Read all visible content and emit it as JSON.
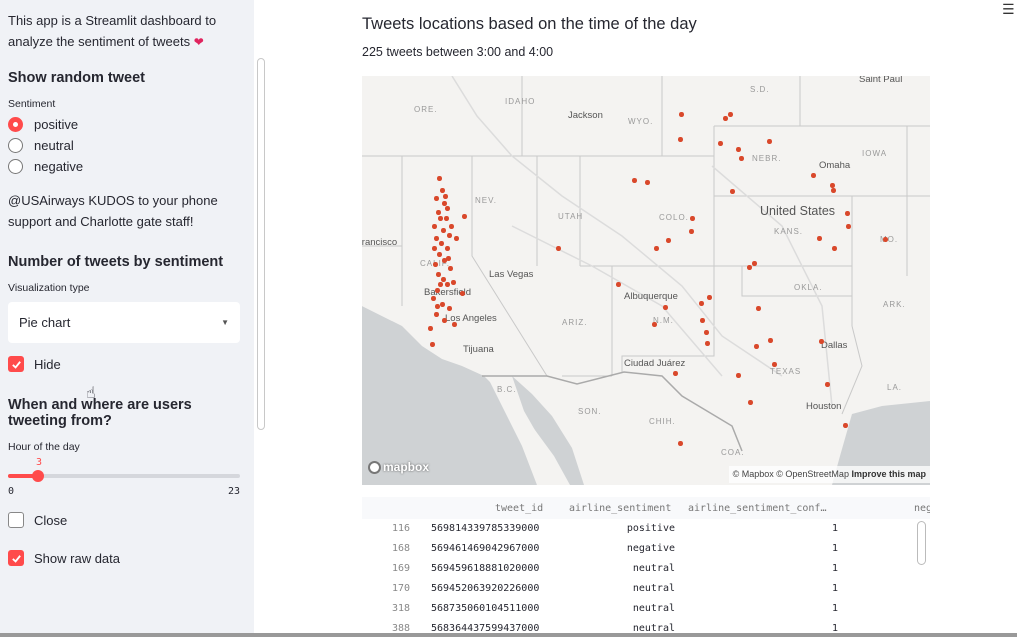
{
  "sidebar": {
    "intro": "This app is a Streamlit dashboard to analyze the sentiment of tweets",
    "random_heading": "Show random tweet",
    "sentiment_label": "Sentiment",
    "sentiments": [
      "positive",
      "neutral",
      "negative"
    ],
    "selected_sentiment": "positive",
    "random_tweet": "@USAirways KUDOS to your phone support and Charlotte gate staff!",
    "count_heading": "Number of tweets by sentiment",
    "viz_label": "Visualization type",
    "viz_value": "Pie chart",
    "hide_label": "Hide",
    "hide_checked": true,
    "when_heading": "When and where are users tweeting from?",
    "hour_label": "Hour of the day",
    "hour_value": "3",
    "hour_fraction": 0.1304,
    "hour_min": "0",
    "hour_max": "23",
    "close_label": "Close",
    "close_checked": false,
    "raw_label": "Show raw data",
    "raw_checked": true,
    "accent": "#ff4b4b"
  },
  "main": {
    "menu_icon": "hamburger-menu-icon",
    "title": "Tweets locations based on the time of the day",
    "subtitle": "225 tweets between 3:00 and 4:00"
  },
  "map": {
    "states": [
      "ORE.",
      "IDAHO",
      "WYO.",
      "NEBR.",
      "IOWA",
      "NEV.",
      "UTAH",
      "COLO.",
      "KANS.",
      "MO.",
      "CALIF.",
      "ARIZ.",
      "N.M.",
      "OKLA.",
      "ARK.",
      "TEXAS",
      "LA.",
      "B.C.",
      "SON.",
      "CHIH.",
      "COA.",
      "S.D."
    ],
    "cities": [
      "Saint Paul",
      "Jackson",
      "Omaha",
      "Las Vegas",
      "Bakersfield",
      "Los Angeles",
      "Tijuana",
      "Albuquerque",
      "Ciudad Juárez",
      "Dallas",
      "Houston",
      "Francisco"
    ],
    "country": "United States",
    "logo": "mapbox",
    "attribution": "© Mapbox © OpenStreetMap",
    "improve": "Improve this map",
    "dot_color": "#d9482b"
  },
  "table": {
    "columns": [
      "tweet_id",
      "airline_sentiment",
      "airline_sentiment_conf…",
      "neg"
    ],
    "rows": [
      {
        "idx": "116",
        "tweet_id": "569814339785339000",
        "sentiment": "positive",
        "conf": "1"
      },
      {
        "idx": "168",
        "tweet_id": "569461469042967000",
        "sentiment": "negative",
        "conf": "1"
      },
      {
        "idx": "169",
        "tweet_id": "569459618881020000",
        "sentiment": "neutral",
        "conf": "1"
      },
      {
        "idx": "170",
        "tweet_id": "569452063920226000",
        "sentiment": "neutral",
        "conf": "1"
      },
      {
        "idx": "318",
        "tweet_id": "568735060104511000",
        "sentiment": "neutral",
        "conf": "1"
      },
      {
        "idx": "388",
        "tweet_id": "568364437599437000",
        "sentiment": "neutral",
        "conf": "1"
      }
    ]
  }
}
